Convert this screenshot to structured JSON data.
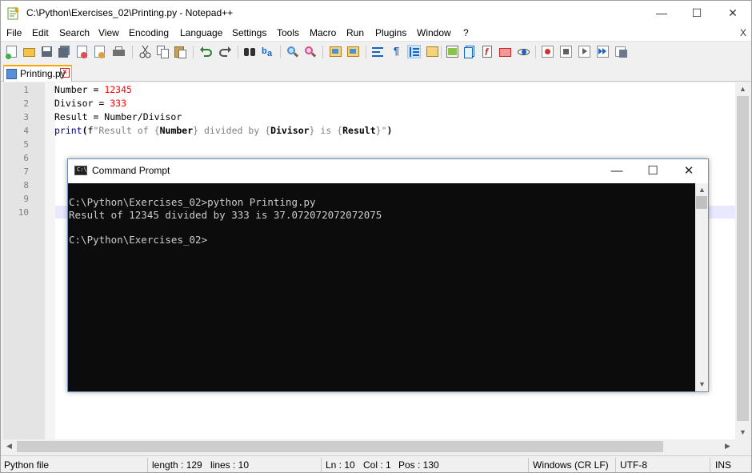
{
  "window": {
    "title": "C:\\Python\\Exercises_02\\Printing.py - Notepad++",
    "minimize": "—",
    "maximize": "☐",
    "close": "✕"
  },
  "menu": {
    "items": [
      "File",
      "Edit",
      "Search",
      "View",
      "Encoding",
      "Language",
      "Settings",
      "Tools",
      "Macro",
      "Run",
      "Plugins",
      "Window",
      "?"
    ],
    "close": "X"
  },
  "toolbar": {
    "icons": [
      "new-file-icon",
      "open-file-icon",
      "save-icon",
      "save-all-icon",
      "close-icon",
      "close-all-icon",
      "print-icon",
      "cut-icon",
      "copy-icon",
      "paste-icon",
      "undo-icon",
      "redo-icon",
      "find-icon",
      "replace-icon",
      "zoom-in-icon",
      "zoom-out-icon",
      "sync-vertical-icon",
      "sync-horizontal-icon",
      "word-wrap-icon",
      "show-all-chars-icon",
      "indent-guide-icon",
      "user-language-icon",
      "doc-map-icon",
      "doc-list-icon",
      "function-list-icon",
      "folder-workspace-icon",
      "monitoring-icon",
      "record-macro-icon",
      "stop-macro-icon",
      "play-macro-icon",
      "run-macro-multiple-icon",
      "save-macro-icon"
    ]
  },
  "tab": {
    "label": "Printing.py",
    "close": "×"
  },
  "editor": {
    "line_numbers": [
      "1",
      "2",
      "3",
      "4",
      "5",
      "6",
      "7",
      "8",
      "9",
      "10"
    ],
    "code": {
      "line1_a": "Number = ",
      "line1_num": "12345",
      "line2_a": "Divisor = ",
      "line2_num": "333",
      "line3": "Result = Number/Divisor",
      "line4_kw": "print",
      "line4_paren": "(",
      "line4_f": "f",
      "line4_s1": "\"Result of {",
      "line4_v1": "Number",
      "line4_s2": "} divided by {",
      "line4_v2": "Divisor",
      "line4_s3": "} is {",
      "line4_v3": "Result",
      "line4_s4": "}\"",
      "line4_end": ")"
    }
  },
  "cmd": {
    "icon_text": "C:\\_",
    "title": "Command Prompt",
    "minimize": "—",
    "maximize": "☐",
    "close": "✕",
    "lines": [
      "C:\\Python\\Exercises_02>python Printing.py",
      "Result of 12345 divided by 333 is 37.072072072072075",
      "",
      "C:\\Python\\Exercises_02>"
    ]
  },
  "status": {
    "file_type": "Python file",
    "length": "length : 129",
    "lines": "lines : 10",
    "ln": "Ln : 10",
    "col": "Col : 1",
    "pos": "Pos : 130",
    "eol": "Windows (CR LF)",
    "encoding": "UTF-8",
    "mode": "INS"
  }
}
